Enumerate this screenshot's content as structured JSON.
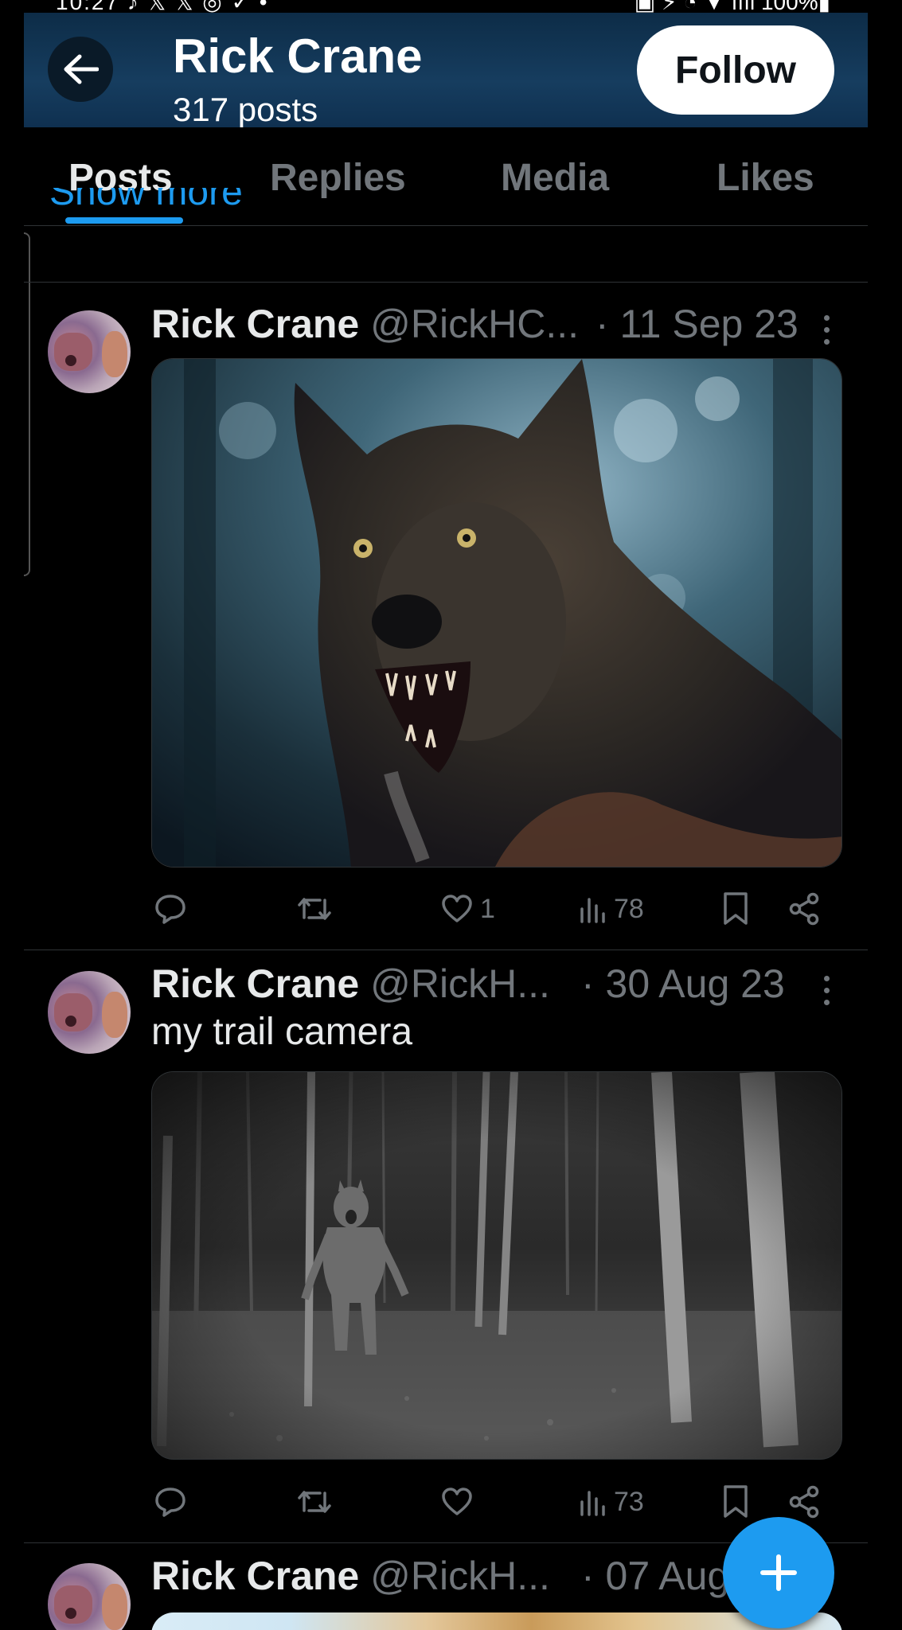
{
  "status_bar": {
    "left": "10:27 ♪ 𝕏 𝕏 ◎ ✓ •",
    "right": "▣ ⚡ ◔ ▼ ıııl 100%▮"
  },
  "header": {
    "title": "Rick Crane",
    "subtitle": "317 posts",
    "follow_label": "Follow",
    "back_icon": "arrow-left-icon",
    "background_color": "#163d5f"
  },
  "tabs": [
    {
      "label": "Posts",
      "active": true
    },
    {
      "label": "Replies",
      "active": false
    },
    {
      "label": "Media",
      "active": false
    },
    {
      "label": "Likes",
      "active": false
    }
  ],
  "show_more_label": "Show more",
  "tweets": [
    {
      "name": "Rick Crane",
      "handle": "@RickHC...",
      "date": "· 11 Sep 23",
      "text": "",
      "media": "werewolf portrait in a dark forest",
      "replies": "",
      "reposts": "",
      "likes": "1",
      "views": "78"
    },
    {
      "name": "Rick Crane",
      "handle": "@RickH...",
      "date": "· 30 Aug 23",
      "text": "my trail camera",
      "media": "night trail camera photo of a werewolf among trees",
      "replies": "",
      "reposts": "",
      "likes": "",
      "views": "73"
    },
    {
      "name": "Rick Crane",
      "handle": "@RickH...",
      "date": "· 07 Aug",
      "text": ""
    }
  ],
  "fab_icon": "plus-icon",
  "colors": {
    "accent": "#1d9bf0",
    "muted": "#71767b",
    "text": "#e7e9ea",
    "background": "#000000"
  }
}
